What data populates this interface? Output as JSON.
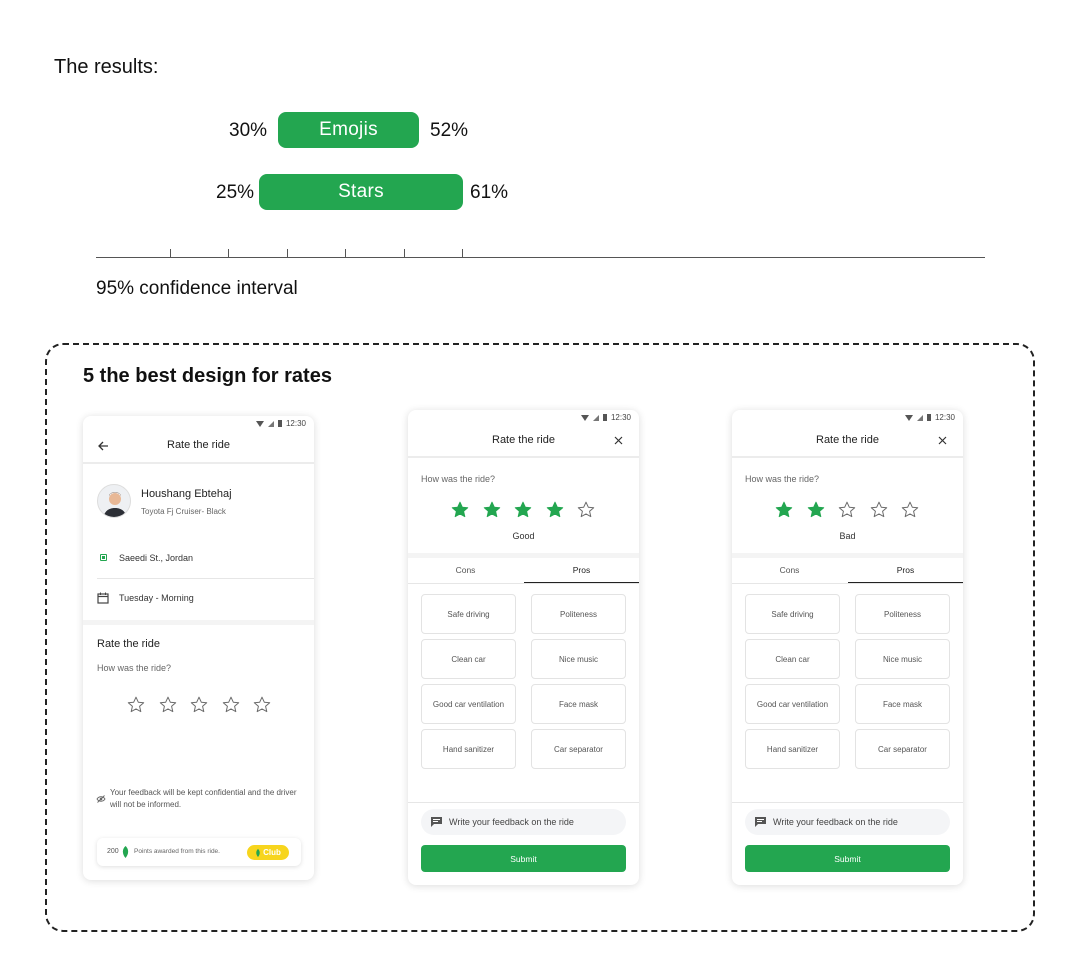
{
  "results": {
    "title": "The results:",
    "axis_caption": "95% confidence interval",
    "bars": [
      {
        "label": "Emojis",
        "low": "30%",
        "high": "52%"
      },
      {
        "label": "Stars",
        "low": "25%",
        "high": "61%"
      }
    ]
  },
  "section": {
    "title": "5 the best design for rates"
  },
  "status_time": "12:30",
  "accent_color": "#23a650",
  "phone1": {
    "header_title": "Rate the ride",
    "driver_name": "Houshang Ebtehaj",
    "car": "Toyota Fj Cruiser- Black",
    "location": "Saeedi St., Jordan",
    "time": "Tuesday - Morning",
    "rate_title": "Rate the ride",
    "question": "How was the ride?",
    "rating": 0,
    "note": "Your feedback will be kept confidential and the driver will not be informed.",
    "points_value": "200",
    "points_text": "Points awarded from this ride.",
    "club_label": "Club"
  },
  "phone2": {
    "header_title": "Rate the ride",
    "question": "How was the ride?",
    "rating": 4,
    "rating_label": "Good",
    "tabs": [
      "Cons",
      "Pros"
    ],
    "active_tab": "Pros",
    "chips": [
      "Safe driving",
      "Politeness",
      "Clean car",
      "Nice music",
      "Good car ventilation",
      "Face mask",
      "Hand sanitizer",
      "Car separator"
    ],
    "feedback_placeholder": "Write your feedback on the ride",
    "submit_label": "Submit"
  },
  "phone3": {
    "header_title": "Rate the ride",
    "question": "How was the ride?",
    "rating": 2,
    "rating_label": "Bad",
    "tabs": [
      "Cons",
      "Pros"
    ],
    "active_tab": "Pros",
    "chips": [
      "Safe driving",
      "Politeness",
      "Clean car",
      "Nice music",
      "Good car ventilation",
      "Face mask",
      "Hand sanitizer",
      "Car separator"
    ],
    "feedback_placeholder": "Write your feedback on the ride",
    "submit_label": "Submit"
  }
}
